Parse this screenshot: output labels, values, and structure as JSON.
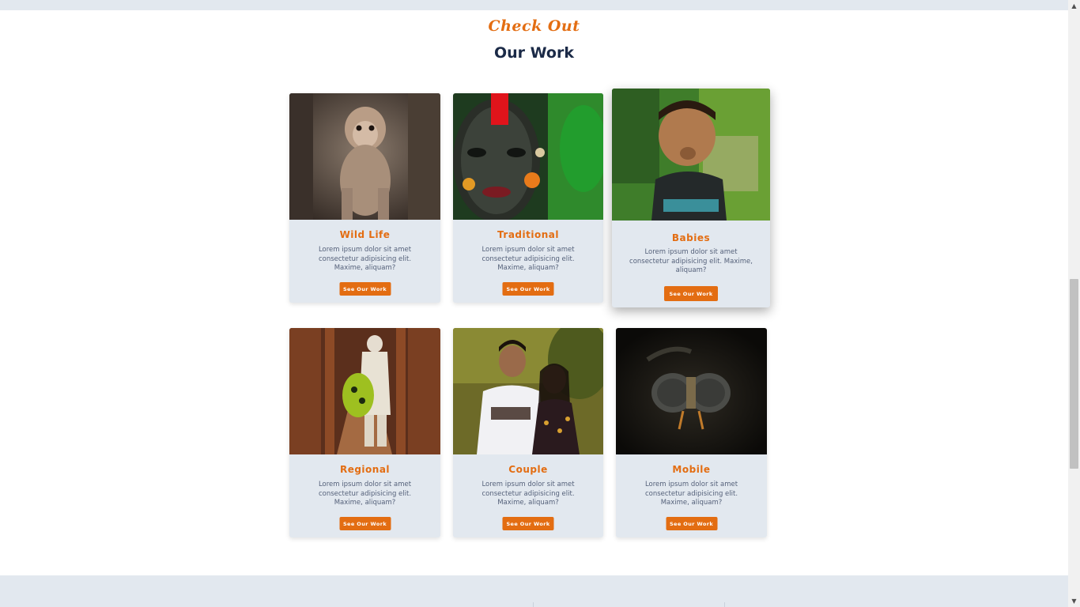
{
  "section": {
    "kicker": "Check Out",
    "title": "Our Work"
  },
  "cards": [
    {
      "title": "Wild Life",
      "description": "Lorem ipsum dolor sit amet consectetur adipisicing elit. Maxime, aliquam?",
      "button": "See Our Work",
      "image": "monkey-photo"
    },
    {
      "title": "Traditional",
      "description": "Lorem ipsum dolor sit amet consectetur adipisicing elit. Maxime, aliquam?",
      "button": "See Our Work",
      "image": "idol-face-photo"
    },
    {
      "title": "Babies",
      "description": "Lorem ipsum dolor sit amet consectetur adipisicing elit. Maxime, aliquam?",
      "button": "See Our Work",
      "image": "child-photo"
    },
    {
      "title": "Regional",
      "description": "Lorem ipsum dolor sit amet consectetur adipisicing elit. Maxime, aliquam?",
      "button": "See Our Work",
      "image": "old-man-corridor-photo"
    },
    {
      "title": "Couple",
      "description": "Lorem ipsum dolor sit amet consectetur adipisicing elit. Maxime, aliquam?",
      "button": "See Our Work",
      "image": "couple-photo"
    },
    {
      "title": "Mobile",
      "description": "Lorem ipsum dolor sit amet consectetur adipisicing elit. Maxime, aliquam?",
      "button": "See Our Work",
      "image": "fly-macro-photo"
    }
  ],
  "colors": {
    "accent": "#e36d12",
    "heading": "#1b2a47",
    "card_bg": "#e2e8ef",
    "body_text": "#55617a"
  }
}
